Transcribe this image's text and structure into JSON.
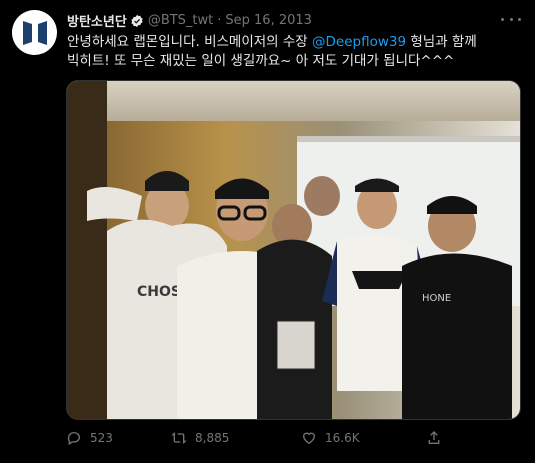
{
  "account": {
    "display_name": "방탄소년단",
    "handle": "@BTS_twt",
    "separator": "·",
    "date": "Sep 16, 2013",
    "verified": true
  },
  "tweet": {
    "text_before": "안녕하세요 랩몬입니다. 비스메이저의 수장 ",
    "mention": "@Deepflow39",
    "text_after": " 형님과 함께 빅히트! 또 무슨 재밌는 일이 생길까요~ 아 저도 기대가 됩니다^^^"
  },
  "actions": {
    "reply_count": "523",
    "retweet_count": "8,885",
    "like_count": "16.6K"
  },
  "icons": {
    "more": "more-horizontal-icon",
    "reply": "reply-icon",
    "retweet": "retweet-icon",
    "like": "heart-icon",
    "share": "share-icon",
    "verified": "verified-badge-icon"
  },
  "colors": {
    "background": "#000000",
    "text": "#e7e9ea",
    "muted": "#71767b",
    "link": "#1d9bf0",
    "avatar_logo": "#1c3f6e"
  }
}
